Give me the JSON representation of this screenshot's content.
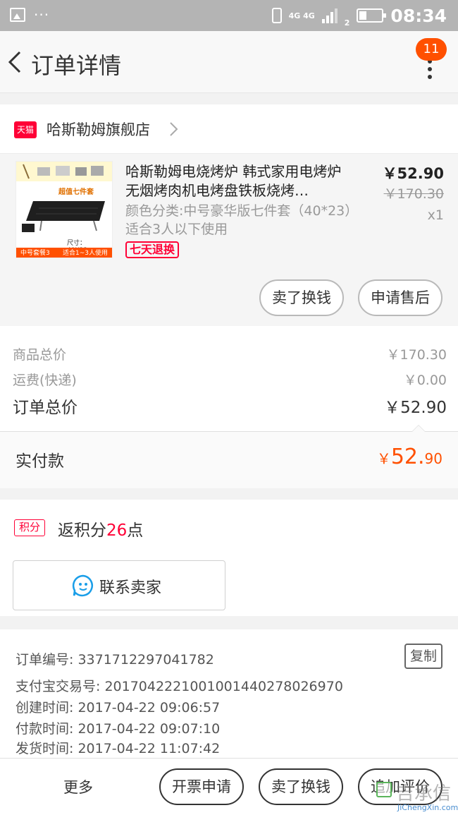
{
  "status_bar": {
    "dots": "···",
    "network": "4G 4G",
    "sim_slot": "2",
    "time": "08:34"
  },
  "nav": {
    "title": "订单详情",
    "badge": "11"
  },
  "shop": {
    "logo_text": "天猫",
    "name": "哈斯勒姆旗舰店"
  },
  "product": {
    "title": "哈斯勒姆电烧烤炉 韩式家用电烤炉 无烟烤肉机电烤盘铁板烧烤…",
    "sku": "颜色分类:中号豪华版七件套（40*23）适合3人以下使用",
    "tag": "七天退换",
    "price": "￥52.90",
    "original_price": "￥170.30",
    "quantity": "x1",
    "image_banner": "超值七件套",
    "image_size_text": "尺寸：40X23cm",
    "image_bottom_left": "中号套餐3",
    "image_bottom_right": "适合1~3人使用",
    "sell_button": "卖了换钱",
    "after_sale_button": "申请售后"
  },
  "summary": {
    "goods_total_label": "商品总价",
    "goods_total_value": "￥170.30",
    "shipping_label": "运费(快递)",
    "shipping_value": "￥0.00",
    "order_total_label": "订单总价",
    "order_total_value": "￥52.90"
  },
  "paid": {
    "label": "实付款",
    "currency": "￥",
    "integer": "52.",
    "decimal": "90"
  },
  "points": {
    "tag": "积分",
    "prefix": "返积分",
    "number": "26",
    "suffix": "点"
  },
  "contact": {
    "label": "联系卖家"
  },
  "order_info": {
    "order_no": "订单编号: 3371712297041782",
    "copy_button": "复制",
    "alipay_no": "支付宝交易号: 2017042221001001440278026970",
    "created": "创建时间: 2017-04-22 09:06:57",
    "paid_time": "付款时间: 2017-04-22 09:07:10",
    "shipped": "发货时间: 2017-04-22 11:07:42"
  },
  "bottom_bar": {
    "more": "更多",
    "invoice": "开票申请",
    "sell": "卖了换钱",
    "review": "追加评价"
  },
  "watermark": {
    "cn": "吉承信",
    "en": "JiChengXin.com"
  },
  "colors": {
    "accent": "#ff5000",
    "tmall_red": "#ff0036"
  }
}
